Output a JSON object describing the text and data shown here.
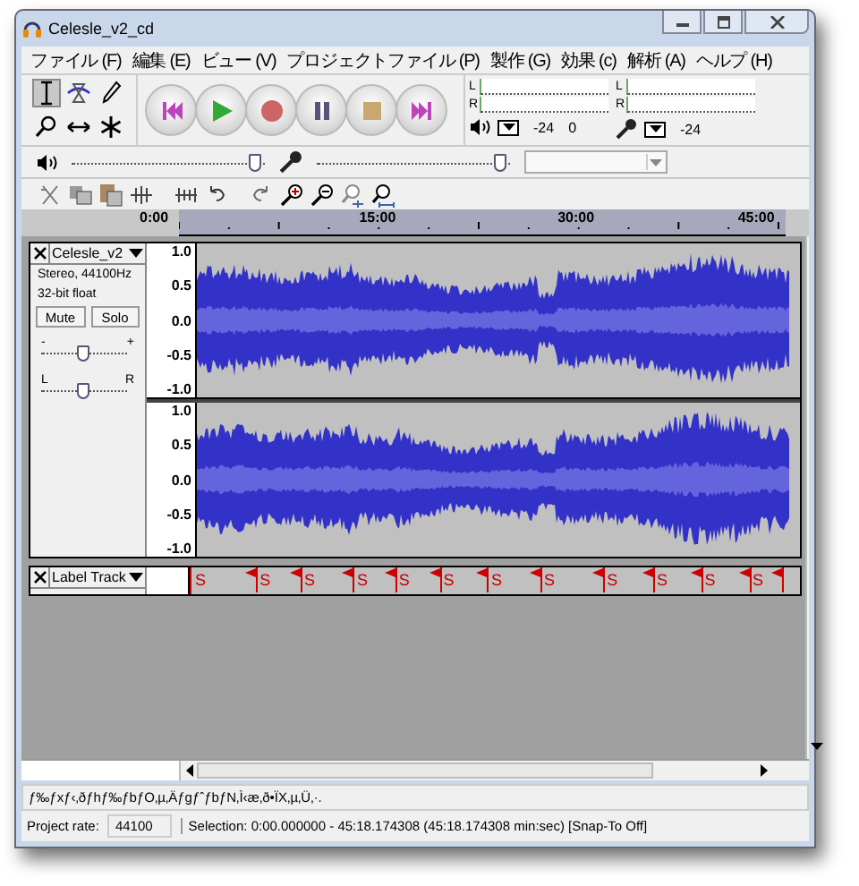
{
  "window": {
    "title": "Celesle_v2_cd"
  },
  "menu": [
    "ファイル (F)",
    "編集 (E)",
    "ビュー (V)",
    "プロジェクトファイル (P)",
    "製作 (G)",
    "効果 (c)",
    "解析 (A)",
    "ヘルプ (H)"
  ],
  "tools": [
    {
      "kind": "select",
      "selected": true
    },
    {
      "kind": "envelope",
      "selected": false
    },
    {
      "kind": "draw",
      "selected": false
    },
    {
      "kind": "zoom",
      "selected": false
    },
    {
      "kind": "timeshift",
      "selected": false
    },
    {
      "kind": "multi",
      "selected": false
    }
  ],
  "transport": [
    {
      "kind": "skip-start"
    },
    {
      "kind": "play"
    },
    {
      "kind": "record"
    },
    {
      "kind": "pause"
    },
    {
      "kind": "stop"
    },
    {
      "kind": "skip-end"
    }
  ],
  "meters": [
    {
      "kind": "output",
      "channels": [
        "L",
        "R"
      ],
      "scale": [
        "-24",
        "0"
      ]
    },
    {
      "kind": "input",
      "channels": [
        "L",
        "R"
      ],
      "scale": [
        "-24"
      ]
    }
  ],
  "mixer": [
    {
      "kind": "output",
      "level": 0.95
    },
    {
      "kind": "input",
      "level": 0.95
    }
  ],
  "edit_tools": [
    {
      "kind": "trim"
    },
    {
      "kind": "copy"
    },
    {
      "kind": "paste"
    },
    {
      "kind": "trim-audio"
    },
    {
      "kind": "silence"
    },
    {
      "kind": "undo"
    },
    {
      "kind": "redo"
    },
    {
      "kind": "zoom-in"
    },
    {
      "kind": "zoom-out"
    },
    {
      "kind": "zoom-selection"
    },
    {
      "kind": "zoom-fit"
    }
  ],
  "ruler": [
    "0:00",
    "15:00",
    "30:00",
    "45:00"
  ],
  "audio_track": {
    "name": "Celesle_v2",
    "info": [
      "Stereo, 44100Hz",
      "32-bit float"
    ],
    "buttons": [
      "Mute",
      "Solo"
    ],
    "gain": {
      "min": "-",
      "max": "+",
      "level": 0.5
    },
    "pan": {
      "min": "L",
      "max": "R",
      "level": 0.5
    },
    "channels": [
      {
        "yticks": [
          "1.0",
          "0.5",
          "0.0",
          "-0.5",
          "-1.0"
        ]
      },
      {
        "yticks": [
          "1.0",
          "0.5",
          "0.0",
          "-0.5",
          "-1.0"
        ]
      }
    ]
  },
  "label_track": {
    "name": "Label Track",
    "labels": [
      {
        "text": "S"
      },
      {
        "text": "S"
      },
      {
        "text": "S"
      },
      {
        "text": "S"
      },
      {
        "text": "S"
      },
      {
        "text": "S"
      },
      {
        "text": "S"
      },
      {
        "text": "S"
      },
      {
        "text": "S"
      },
      {
        "text": "S"
      },
      {
        "text": "S"
      },
      {
        "text": "S"
      }
    ]
  },
  "status_message": "ƒ‰ƒxƒ‹‚ðƒhƒ‰ƒbƒO‚µ‚ÄƒgƒˆƒbƒN‚Ì‹æ‚ð•ÏX‚µ‚Ü‚·.",
  "status_bar": {
    "rate_label": "Project rate:",
    "rate": "44100",
    "selection": "Selection: 0:00.000000 - 45:18.174308 (45:18.174308 min:sec)  [Snap-To Off]"
  }
}
